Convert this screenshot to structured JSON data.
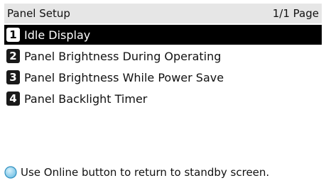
{
  "header": {
    "title": "Panel Setup",
    "page_indicator": "1/1 Page"
  },
  "menu": {
    "items": [
      {
        "number": "1",
        "label": "Idle Display",
        "selected": true
      },
      {
        "number": "2",
        "label": "Panel Brightness During Operating",
        "selected": false
      },
      {
        "number": "3",
        "label": "Panel Brightness While Power Save",
        "selected": false
      },
      {
        "number": "4",
        "label": "Panel Backlight Timer",
        "selected": false
      }
    ]
  },
  "footer": {
    "icon": "online-button-icon",
    "text": "Use Online button to return to standby screen."
  },
  "colors": {
    "header_bg": "#e6e6e6",
    "selected_bg": "#000000",
    "online_icon_fill": "#7ec8ea",
    "online_icon_stroke": "#2f8fbf"
  }
}
